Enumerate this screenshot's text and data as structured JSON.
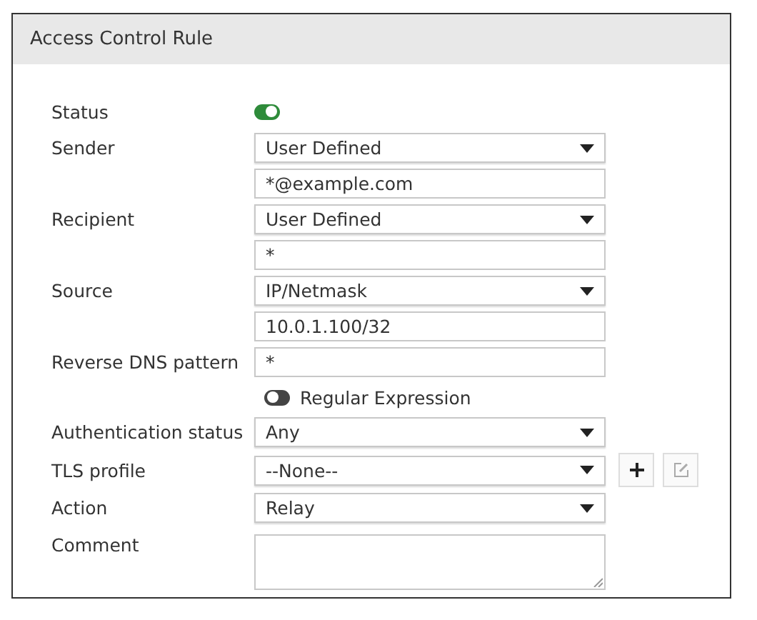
{
  "panel": {
    "title": "Access Control Rule"
  },
  "rows": [
    {
      "kind": "toggle",
      "label": "Status",
      "on": true
    },
    {
      "kind": "select",
      "label": "Sender",
      "value": "User Defined"
    },
    {
      "kind": "input",
      "value": "*@example.com"
    },
    {
      "kind": "select",
      "label": "Recipient",
      "value": "User Defined"
    },
    {
      "kind": "input",
      "value": "*"
    },
    {
      "kind": "select",
      "label": "Source",
      "value": "IP/Netmask"
    },
    {
      "kind": "input",
      "value": "10.0.1.100/32"
    },
    {
      "kind": "input",
      "label": "Reverse DNS pattern",
      "value": "*"
    },
    {
      "kind": "toggle",
      "text": "Regular Expression",
      "on": false
    },
    {
      "kind": "select",
      "label": "Authentication status",
      "value": "Any"
    },
    {
      "kind": "select",
      "label": "TLS profile",
      "value": "--None--",
      "actions": [
        {
          "kind": "add",
          "disabled": false
        },
        {
          "kind": "edit",
          "disabled": true
        }
      ]
    },
    {
      "kind": "select",
      "label": "Action",
      "value": "Relay"
    },
    {
      "kind": "textarea",
      "label": "Comment"
    }
  ]
}
